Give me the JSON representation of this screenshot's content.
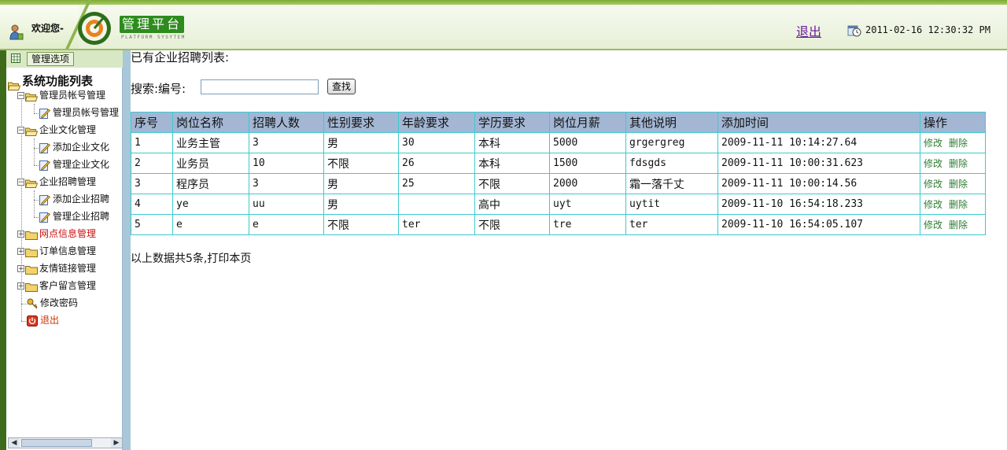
{
  "header": {
    "welcome": "欢迎您-",
    "logo_title": "管理平台",
    "logo_subtitle": "PLATFORM SYSYTEM",
    "logout": "退出",
    "datetime": "2011-02-16 12:30:32 PM"
  },
  "sidebar": {
    "head_button": "管理选项",
    "tree_title": "系统功能列表",
    "items": [
      {
        "label": "管理员帐号管理",
        "type": "folder",
        "expanded": true
      },
      {
        "label": "管理员帐号管理",
        "type": "page"
      },
      {
        "label": "企业文化管理",
        "type": "folder",
        "expanded": true
      },
      {
        "label": "添加企业文化",
        "type": "page"
      },
      {
        "label": "管理企业文化",
        "type": "page"
      },
      {
        "label": "企业招聘管理",
        "type": "folder",
        "expanded": true
      },
      {
        "label": "添加企业招聘",
        "type": "page"
      },
      {
        "label": "管理企业招聘",
        "type": "page"
      },
      {
        "label": "网点信息管理",
        "type": "folder",
        "expanded": false
      },
      {
        "label": "订单信息管理",
        "type": "folder",
        "expanded": false
      },
      {
        "label": "友情链接管理",
        "type": "folder",
        "expanded": false
      },
      {
        "label": "客户留言管理",
        "type": "folder",
        "expanded": false
      },
      {
        "label": "修改密码",
        "type": "key"
      },
      {
        "label": "退出",
        "type": "exit"
      }
    ]
  },
  "main": {
    "title": "已有企业招聘列表:",
    "search_label": "搜索:编号:",
    "search_value": "",
    "search_button": "查找",
    "columns": [
      "序号",
      "岗位名称",
      "招聘人数",
      "性别要求",
      "年龄要求",
      "学历要求",
      "岗位月薪",
      "其他说明",
      "添加时间",
      "操作"
    ],
    "rows": [
      [
        "1",
        "业务主管",
        "3",
        "男",
        "30",
        "本科",
        "5000",
        "grgergreg",
        "2009-11-11 10:14:27.64"
      ],
      [
        "2",
        "业务员",
        "10",
        "不限",
        "26",
        "本科",
        "1500",
        "fdsgds",
        "2009-11-11 10:00:31.623"
      ],
      [
        "3",
        "程序员",
        "3",
        "男",
        "25",
        "不限",
        "2000",
        "霜一落千丈",
        "2009-11-11 10:00:14.56"
      ],
      [
        "4",
        "ye",
        "uu",
        "男",
        "",
        "高中",
        "uyt",
        "uytit",
        "2009-11-10 16:54:18.233"
      ],
      [
        "5",
        "e",
        "e",
        "不限",
        "ter",
        "不限",
        "tre",
        "ter",
        "2009-11-10 16:54:05.107"
      ]
    ],
    "action_edit": "修改",
    "action_delete": "删除",
    "summary": "以上数据共5条,打印本页"
  },
  "colors": {
    "accent_green": "#2e8b1e",
    "table_header": "#a3b7d5",
    "table_border": "#3ec9cf",
    "action_link": "#2e7d32"
  }
}
